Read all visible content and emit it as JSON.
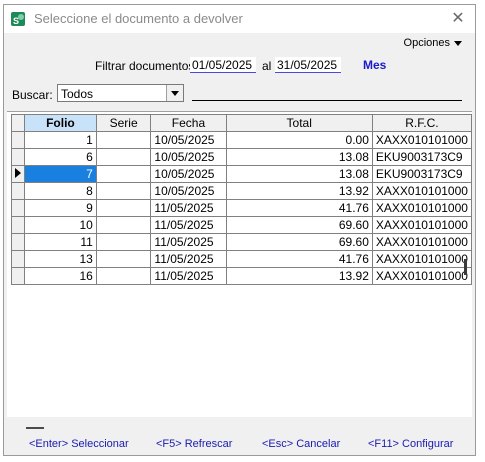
{
  "window": {
    "title": "Seleccione el documento a devolver"
  },
  "toolbar": {
    "options_label": "Opciones"
  },
  "filter": {
    "label": "Filtrar documentos",
    "date_from": "01/05/2025",
    "between_label": "al",
    "date_to": "31/05/2025",
    "period_link": "Mes"
  },
  "search": {
    "label": "Buscar:",
    "selected_option": "Todos",
    "value": ""
  },
  "table": {
    "columns": [
      "Folio",
      "Serie",
      "Fecha",
      "Total",
      "R.F.C."
    ],
    "rows": [
      {
        "folio": "1",
        "serie": "",
        "fecha": "10/05/2025",
        "total": "0.00",
        "rfc": "XAXX010101000"
      },
      {
        "folio": "6",
        "serie": "",
        "fecha": "10/05/2025",
        "total": "13.08",
        "rfc": "EKU9003173C9"
      },
      {
        "folio": "7",
        "serie": "",
        "fecha": "10/05/2025",
        "total": "13.08",
        "rfc": "EKU9003173C9"
      },
      {
        "folio": "8",
        "serie": "",
        "fecha": "10/05/2025",
        "total": "13.92",
        "rfc": "XAXX010101000"
      },
      {
        "folio": "9",
        "serie": "",
        "fecha": "11/05/2025",
        "total": "41.76",
        "rfc": "XAXX010101000"
      },
      {
        "folio": "10",
        "serie": "",
        "fecha": "11/05/2025",
        "total": "69.60",
        "rfc": "XAXX010101000"
      },
      {
        "folio": "11",
        "serie": "",
        "fecha": "11/05/2025",
        "total": "69.60",
        "rfc": "XAXX010101000"
      },
      {
        "folio": "13",
        "serie": "",
        "fecha": "11/05/2025",
        "total": "41.76",
        "rfc": "XAXX010101000"
      },
      {
        "folio": "16",
        "serie": "",
        "fecha": "11/05/2025",
        "total": "13.92",
        "rfc": "XAXX010101000"
      }
    ],
    "selected_row": 2
  },
  "shortcuts": {
    "select": "<Enter> Seleccionar",
    "refresh": "<F5> Refrescar",
    "cancel": "<Esc> Cancelar",
    "configure": "<F11> Configurar"
  },
  "colors": {
    "accent": "#1a80e0",
    "link": "#1a1ab0",
    "app_icon": "#1e8a5a"
  }
}
